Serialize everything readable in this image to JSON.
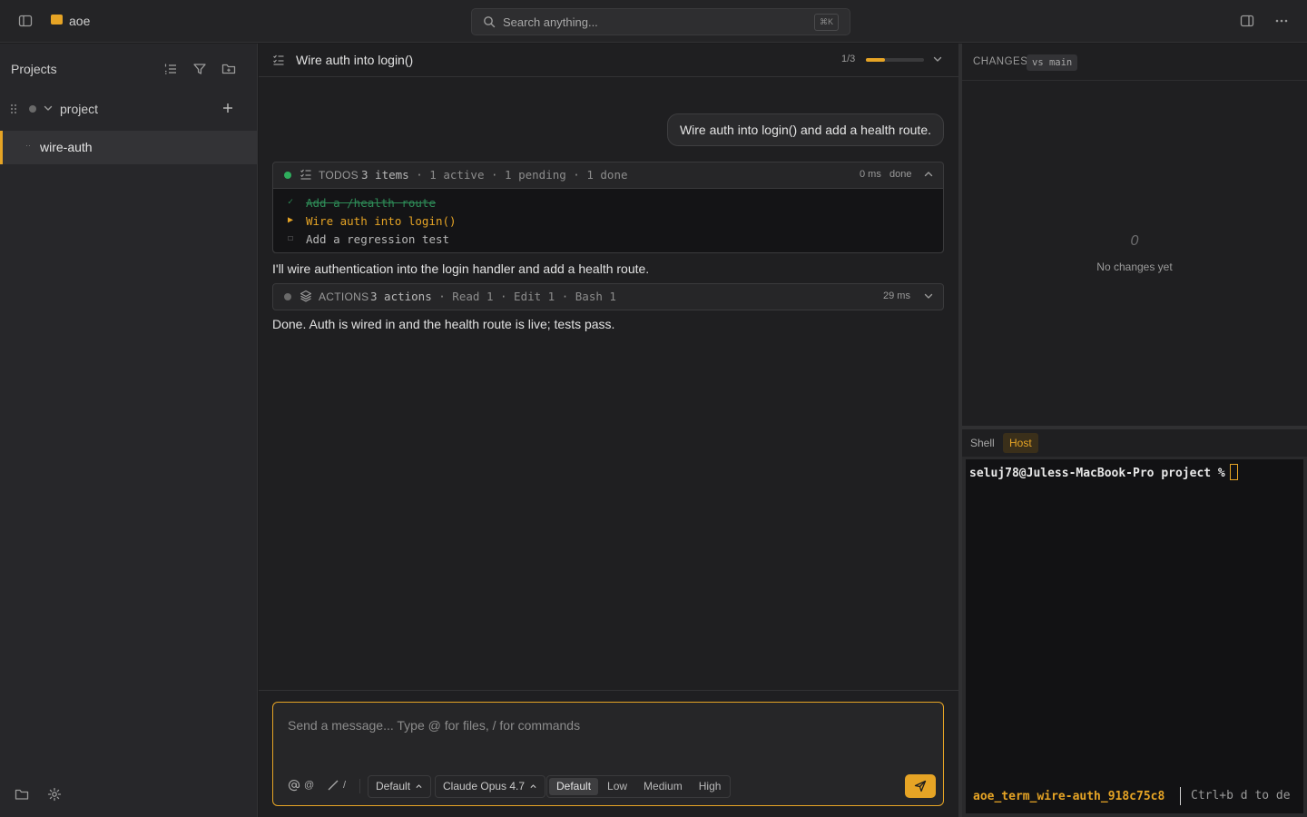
{
  "topbar": {
    "app_title": "aoe",
    "search_placeholder": "Search anything...",
    "search_shortcut": "⌘K"
  },
  "sidebar": {
    "title": "Projects",
    "project": {
      "name": "project"
    },
    "session": {
      "name": "wire-auth",
      "prefix": "··"
    }
  },
  "chat": {
    "title": "Wire auth into login()",
    "progress": {
      "text": "1/3",
      "fraction": 0.33
    },
    "user_message": "Wire auth into login() and add a health route.",
    "todos_card": {
      "kind": "TODOS",
      "summary_main": "3 items",
      "summary_rest": " · 1 active · 1 pending · 1 done",
      "duration": "0 ms",
      "state": "done",
      "items": [
        {
          "mark": "✓",
          "text": "Add a /health route",
          "status": "done"
        },
        {
          "mark": "▶",
          "text": "Wire auth into login()",
          "status": "active"
        },
        {
          "mark": "☐",
          "text": "Add a regression test",
          "status": "pending"
        }
      ]
    },
    "assistant_message_1": "I'll wire authentication into the login handler and add a health route.",
    "actions_card": {
      "kind": "ACTIONS",
      "summary_main": "3 actions",
      "summary_rest": " · Read 1 · Edit 1 · Bash 1",
      "duration": "29 ms"
    },
    "assistant_message_2": "Done. Auth is wired in and the health route is live; tests pass.",
    "composer": {
      "placeholder": "Send a message...  Type @ for files, / for commands",
      "mention_label": "@",
      "command_label": "/",
      "mode_dropdown": "Default",
      "model_dropdown": "Claude Opus 4.7",
      "effort_options": [
        "Default",
        "Low",
        "Medium",
        "High"
      ],
      "effort_selected": "Default"
    }
  },
  "changes": {
    "title": "CHANGES",
    "badge": "vs main",
    "empty_glyph": "0",
    "empty_text": "No changes yet"
  },
  "terminal": {
    "tabs": [
      "Shell",
      "Host"
    ],
    "active_tab": "Host",
    "prompt": "seluj78@Juless-MacBook-Pro project %",
    "session_name": "aoe_term_wire-auth_918c75c8",
    "detach_hint": "Ctrl+b d to de"
  },
  "colors": {
    "accent": "#e6a425",
    "done_green": "#2e8b57",
    "background": "#1c1c1e"
  }
}
